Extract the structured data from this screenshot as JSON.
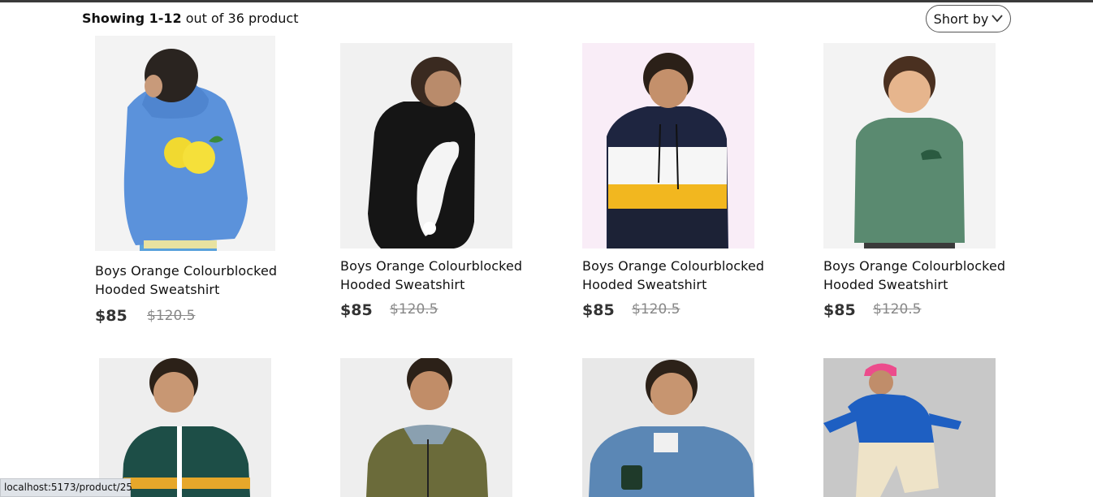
{
  "header": {
    "showing_bold": "Showing 1-12",
    "showing_rest": " out of 36 product",
    "sort_label": "Short by"
  },
  "products": [
    {
      "name": "Boys Orange Colourblocked Hooded Sweatshirt",
      "price": "$85",
      "old_price": "$120.5",
      "image": "boy-blue-lemon-hoodie"
    },
    {
      "name": "Boys Orange Colourblocked Hooded Sweatshirt",
      "price": "$85",
      "old_price": "$120.5",
      "image": "boy-black-hoodie"
    },
    {
      "name": "Boys Orange Colourblocked Hooded Sweatshirt",
      "price": "$85",
      "old_price": "$120.5",
      "image": "boy-striped-hoodie"
    },
    {
      "name": "Boys Orange Colourblocked Hooded Sweatshirt",
      "price": "$85",
      "old_price": "$120.5",
      "image": "boy-green-sweatshirt"
    },
    {
      "image": "boy-green-track-jacket"
    },
    {
      "image": "boy-olive-quilted-jacket"
    },
    {
      "image": "boy-denim-jacket"
    },
    {
      "image": "boy-blue-sweatshirt-pink-cap"
    }
  ],
  "status_bar": {
    "url": "localhost:5173/product/25"
  }
}
